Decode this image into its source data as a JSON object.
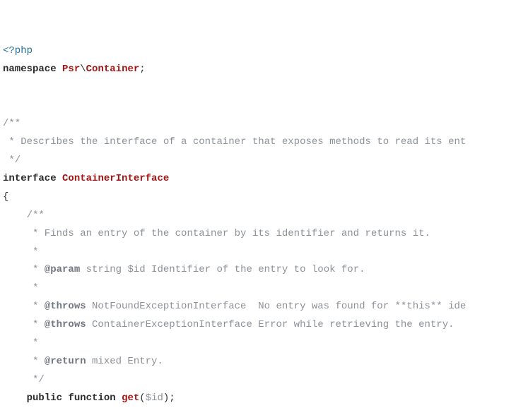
{
  "l1_open": "<?php",
  "l2_kw": "namespace",
  "l2_ns1": "Psr",
  "l2_sep": "\\",
  "l2_ns2": "Container",
  "l2_semi": ";",
  "c_open": "/**",
  "c_desc": " * Describes the interface of a container that exposes methods to read its ent",
  "c_close": " */",
  "if_kw": "interface",
  "if_name": "ContainerInterface",
  "brace_open": "{",
  "m_c_open": "    /**",
  "m_c_l1": "     * Finds an entry of the container by its identifier and returns it.",
  "m_c_star1": "     *",
  "m_c_param_pre": "     * ",
  "m_c_param_tag": "@param",
  "m_c_param_rest": " string $id Identifier of the entry to look for.",
  "m_c_star2": "     *",
  "m_c_throws1_pre": "     * ",
  "m_c_throws_tag": "@throws",
  "m_c_throws1_rest": " NotFoundExceptionInterface  No entry was found for **this** ide",
  "m_c_throws2_rest": " ContainerExceptionInterface Error while retrieving the entry.",
  "m_c_star3": "     *",
  "m_c_return_tag": "@return",
  "m_c_return_rest": " mixed Entry.",
  "m_c_close": "     */",
  "m_indent": "    ",
  "m_public": "public",
  "m_function": "function",
  "m_name": "get",
  "m_paren_open": "(",
  "m_var": "$id",
  "m_paren_close": ")",
  "m_semi": ";"
}
